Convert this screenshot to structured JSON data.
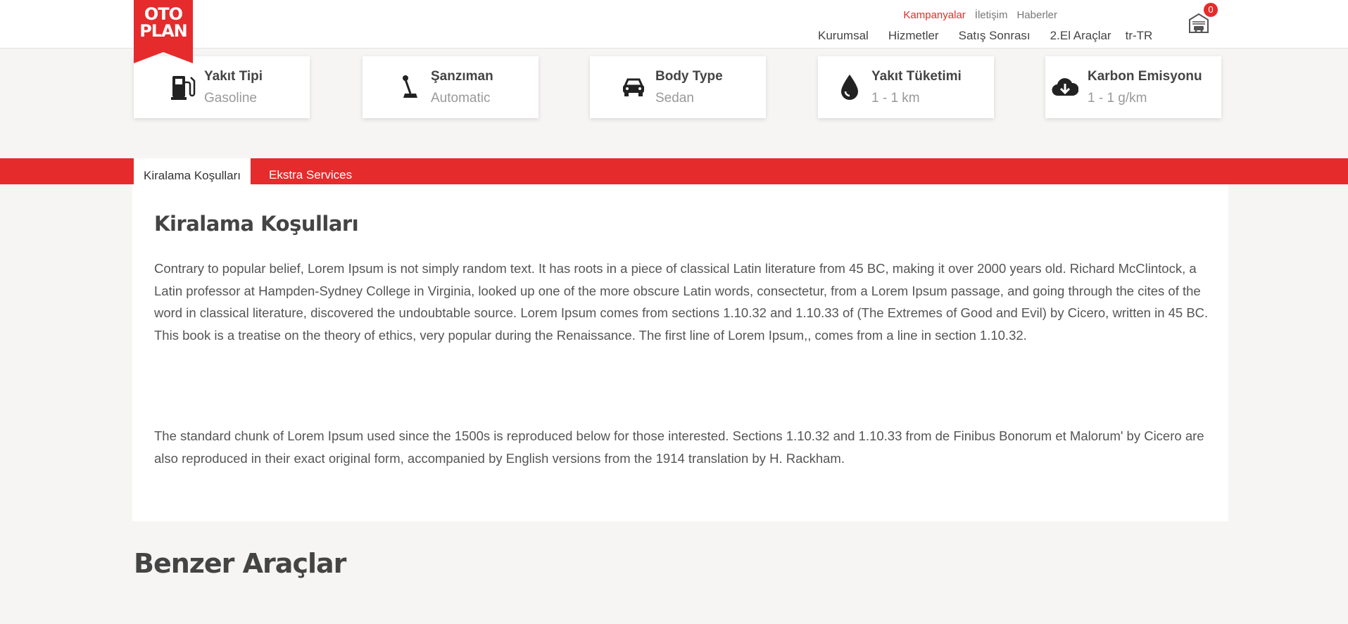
{
  "brand": {
    "logo_text_line1": "OTO",
    "logo_text_line2": "PLAN",
    "accent_color": "#e52b2b"
  },
  "header": {
    "top_links": [
      "Kampanyalar",
      "İletişim",
      "Haberler"
    ],
    "main_nav": [
      "Kurumsal",
      "Hizmetler",
      "Satış Sonrası",
      "2.El Araçlar"
    ],
    "language": "tr-TR",
    "garage_count": "0"
  },
  "features": [
    {
      "icon": "fuel-pump-icon",
      "title": "Yakıt Tipi",
      "value": "Gasoline"
    },
    {
      "icon": "gear-shift-icon",
      "title": "Şanzıman",
      "value": "Automatic"
    },
    {
      "icon": "car-icon",
      "title": "Body Type",
      "value": "Sedan"
    },
    {
      "icon": "drop-icon",
      "title": "Yakıt Tüketimi",
      "value": "1 - 1 km"
    },
    {
      "icon": "cloud-download-icon",
      "title": "Karbon Emisyonu",
      "value": "1 - 1 g/km"
    }
  ],
  "tabs": [
    {
      "label": "Kiralama Koşulları",
      "active": true
    },
    {
      "label": "Ekstra Services",
      "active": false
    }
  ],
  "content": {
    "heading": "Kiralama Koşulları",
    "paragraph1": "Contrary to popular belief, Lorem Ipsum is not simply random text. It has roots in a piece of classical Latin literature from 45 BC, making it over 2000 years old. Richard McClintock, a Latin professor at Hampden-Sydney College in Virginia, looked up one of the more obscure Latin words, consectetur, from a Lorem Ipsum passage, and going through the cites of the word in classical literature, discovered the undoubtable source. Lorem Ipsum comes from sections 1.10.32 and 1.10.33 of (The Extremes of Good and Evil) by Cicero, written in 45 BC. This book is a treatise on the theory of ethics, very popular during the Renaissance. The first line of Lorem Ipsum,, comes from a line in section 1.10.32.",
    "paragraph2": "The standard chunk of Lorem Ipsum used since the 1500s is reproduced below for those interested. Sections 1.10.32 and 1.10.33 from de Finibus Bonorum et Malorum' by Cicero are also reproduced in their exact original form, accompanied by English versions from the 1914 translation by H. Rackham."
  },
  "similar_heading": "Benzer Araçlar"
}
